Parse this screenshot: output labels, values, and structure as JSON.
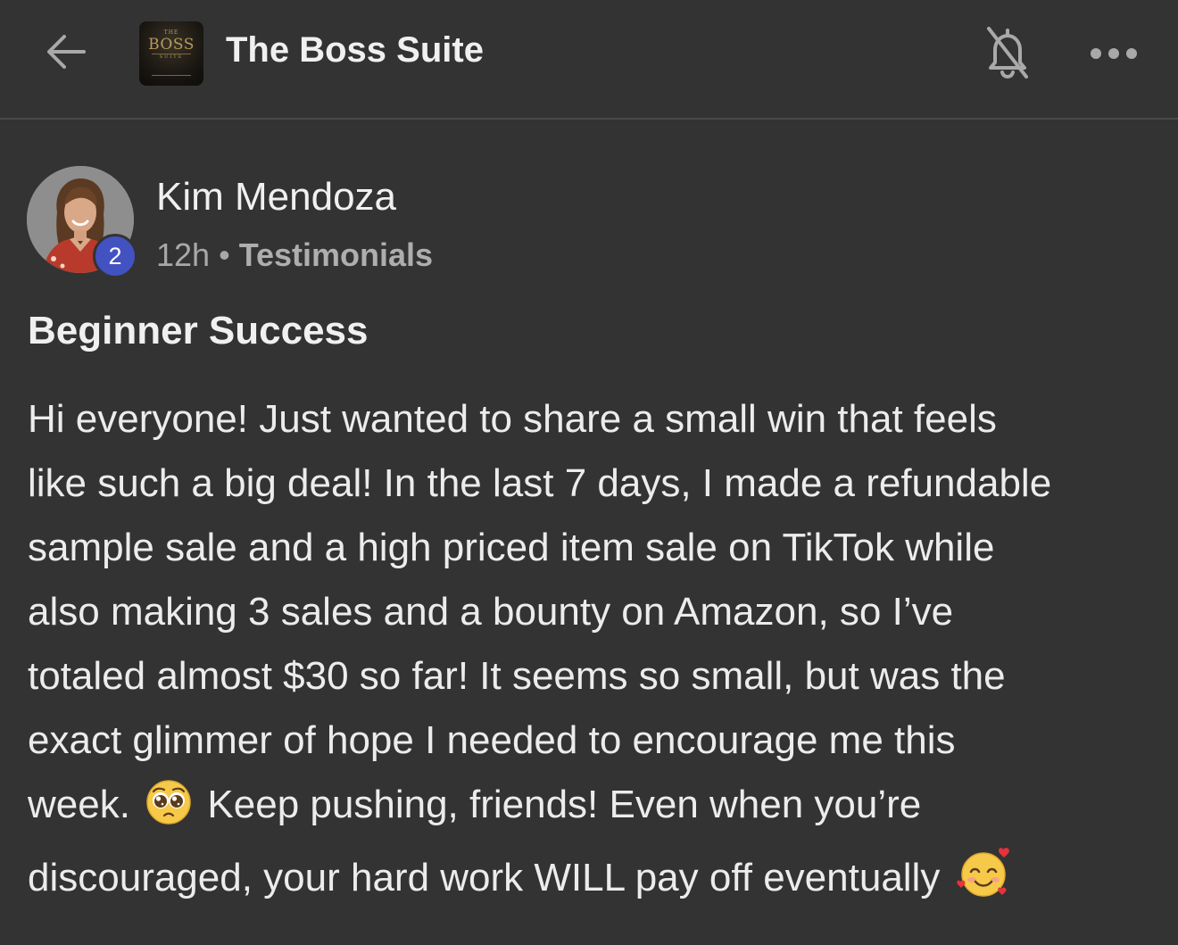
{
  "header": {
    "back_icon": "arrow-left-icon",
    "logo": {
      "top_text": "THE",
      "main_text": "BOSS",
      "bottom_text": "SUITE"
    },
    "title": "The Boss Suite",
    "notification_icon": "bell-off-icon",
    "more_icon": "more-horizontal-icon"
  },
  "post": {
    "author": {
      "name": "Kim Mendoza",
      "level": "2"
    },
    "time": "12h",
    "separator": "•",
    "category": "Testimonials",
    "title": "Beginner Success",
    "body_lines": [
      "Hi everyone! Just wanted to share a small win that feels",
      "like such a big deal! In the last 7 days, I made a refundable",
      "sample sale and a high priced item sale on TikTok while",
      "also making 3 sales and a bounty on Amazon, so I’ve",
      "totaled almost $30 so far! It seems so small, but was the",
      "exact glimmer of hope I needed to encourage me this"
    ],
    "body_line7": {
      "before": "week.",
      "after": "Keep pushing, friends! Even when you’re"
    },
    "body_line8": "discouraged, your hard work WILL pay off eventually",
    "emojis": [
      "pleading-face",
      "smiling-face-with-hearts"
    ]
  },
  "colors": {
    "background": "#333333",
    "text": "#ededed",
    "muted": "#a8a8a8",
    "badge": "#4352c1",
    "divider": "#4a4a4a"
  }
}
